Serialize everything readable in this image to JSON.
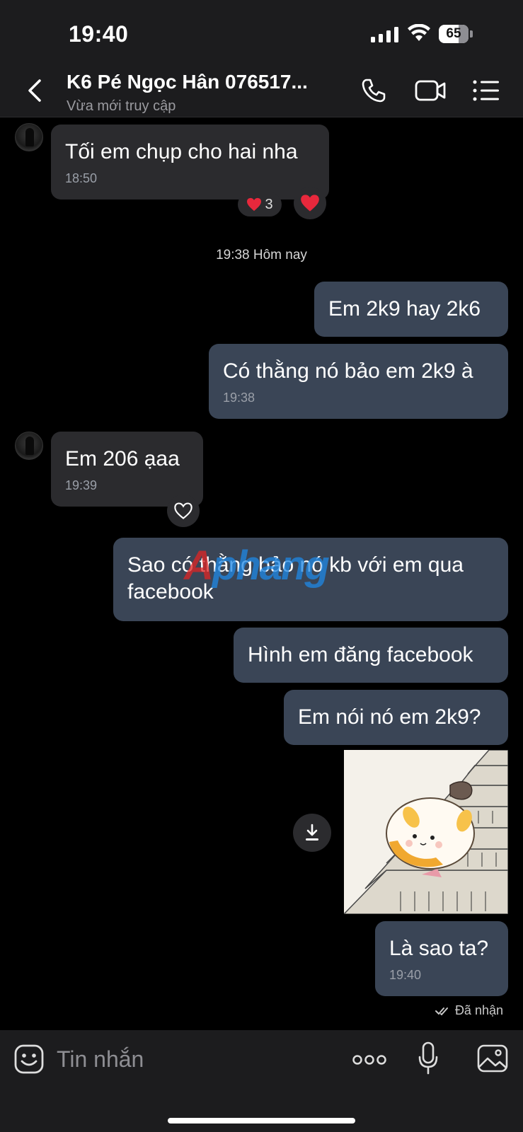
{
  "status_bar": {
    "time": "19:40",
    "battery": "65"
  },
  "header": {
    "contact_name": "K6 Pé Ngọc Hân 076517...",
    "contact_status": "Vừa mới truy cập"
  },
  "messages": [
    {
      "dir": "in",
      "text": "Tối em chụp cho hai nha",
      "time": "18:50",
      "reaction_count": "3"
    },
    {
      "dir": "out",
      "text": "Em 2k9 hay 2k6",
      "time": ""
    },
    {
      "dir": "out",
      "text": "Có thằng nó bảo em 2k9 à",
      "time": "19:38"
    },
    {
      "dir": "in",
      "text": "Em 206 ạaa",
      "time": "19:39"
    },
    {
      "dir": "out",
      "text": "Sao có thằng bảo nó kb với em qua facebook",
      "time": ""
    },
    {
      "dir": "out",
      "text": "Hình em đăng facebook",
      "time": ""
    },
    {
      "dir": "out",
      "text": "Em nói nó em 2k9?",
      "time": ""
    },
    {
      "dir": "out",
      "text": "Là sao ta?",
      "time": "19:40"
    }
  ],
  "date_separator": "19:38 Hôm nay",
  "receipt": "Đã nhận",
  "watermark": {
    "part1": "A",
    "part2": "phang"
  },
  "composer": {
    "placeholder": "Tin nhắn"
  },
  "colors": {
    "incoming_bubble": "#2b2b2e",
    "outgoing_bubble": "#3a4556",
    "background": "#000000",
    "heart": "#e8283c"
  },
  "icons": [
    "back-icon",
    "call-icon",
    "video-call-icon",
    "menu-icon",
    "heart-icon",
    "download-icon",
    "emoji-icon",
    "more-icon",
    "mic-icon",
    "image-icon"
  ]
}
